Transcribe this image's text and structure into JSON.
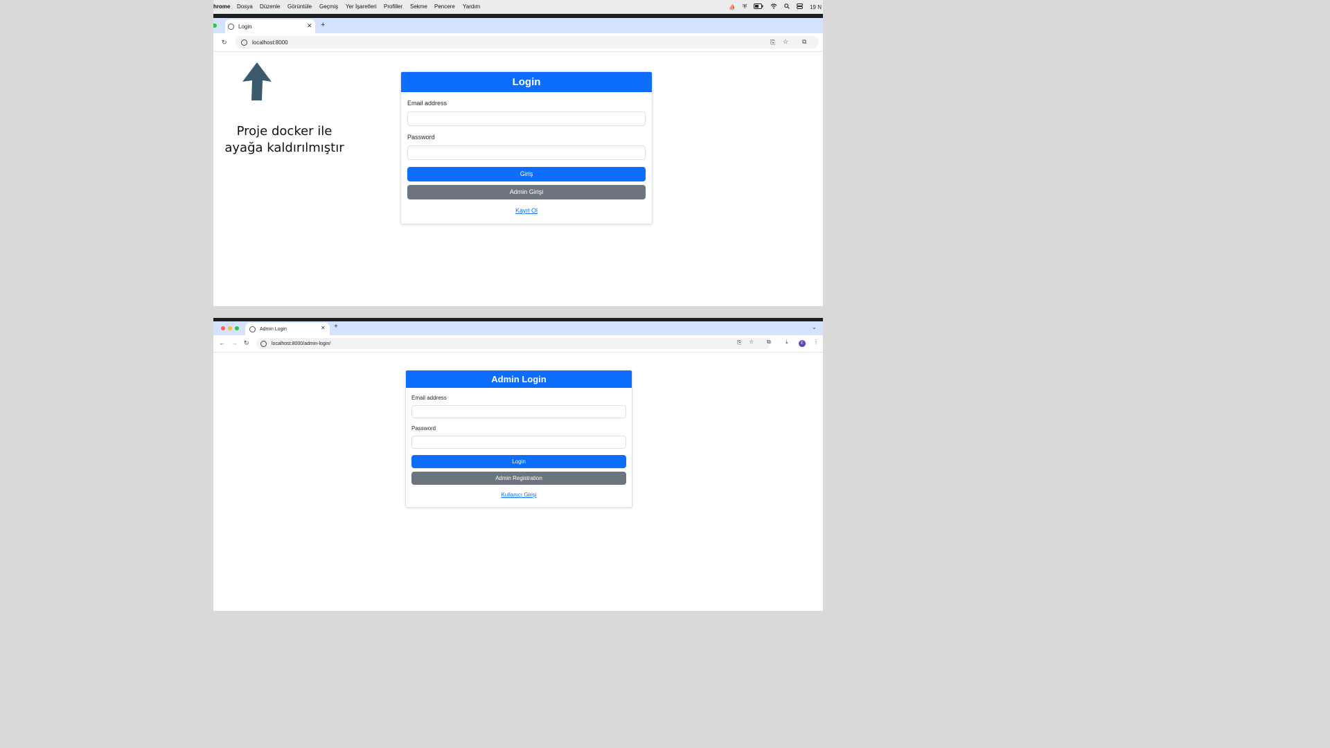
{
  "menubar": {
    "app": "hrome",
    "items": [
      "Dosya",
      "Düzenle",
      "Görüntüle",
      "Geçmiş",
      "Yer İşaretleri",
      "Profiller",
      "Sekme",
      "Pencere",
      "Yardım"
    ],
    "clock": "19 N"
  },
  "window1": {
    "tab_title": "Login",
    "url": "localhost:8000",
    "card": {
      "title": "Login",
      "email_label": "Email address",
      "password_label": "Password",
      "primary_button": "Giriş",
      "secondary_button": "Admin Girişi",
      "link": "Kayıt Ol"
    }
  },
  "annotation": {
    "line1": "Proje docker ile",
    "line2": "ayağa kaldırılmıştır",
    "arrow_color": "#3b5a6e"
  },
  "window2": {
    "tab_title": "Admin Login",
    "url": "localhost:8000/admin-login/",
    "profile_initial": "E",
    "card": {
      "title": "Admin Login",
      "email_label": "Email address",
      "password_label": "Password",
      "primary_button": "Login",
      "secondary_button": "Admin Registration",
      "link": "Kullanıcı Girişi"
    }
  },
  "colors": {
    "primary": "#0d6efd",
    "secondary": "#6c757d",
    "tabbar": "#d3e3fd"
  }
}
